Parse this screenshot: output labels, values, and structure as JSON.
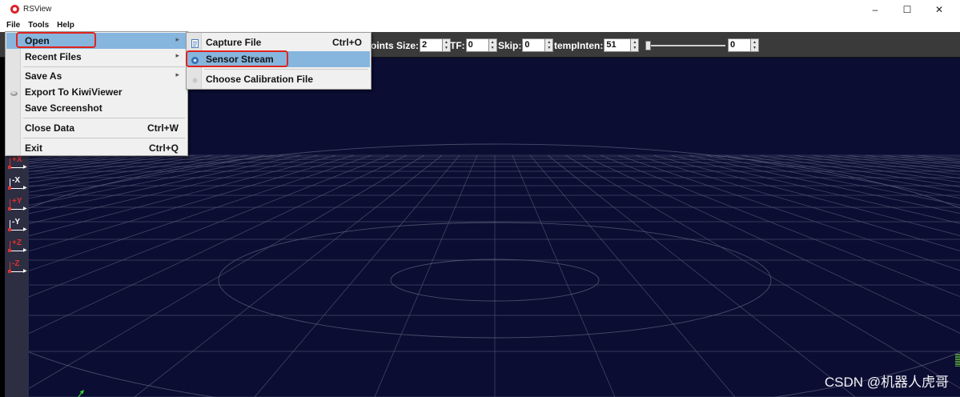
{
  "window": {
    "title": "RSView",
    "controls": {
      "minimize": "–",
      "maximize": "☐",
      "close": "✕"
    }
  },
  "menubar": {
    "items": [
      "File",
      "Tools",
      "Help"
    ]
  },
  "toolbar": {
    "points_size": {
      "label": "oints Size:",
      "value": "2"
    },
    "tf": {
      "label": "TF:",
      "value": "0"
    },
    "skip": {
      "label": "Skip:",
      "value": "0"
    },
    "temp_inten": {
      "label": "tempInten:",
      "value": "51"
    },
    "slider": {
      "value": "0"
    }
  },
  "file_menu": {
    "open": {
      "label": "Open",
      "arrow": "▸"
    },
    "recent_files": {
      "label": "Recent Files",
      "arrow": "▸"
    },
    "save_as": {
      "label": "Save As",
      "arrow": "▸"
    },
    "export_kiwiviewer": {
      "label": "Export To KiwiViewer"
    },
    "save_screenshot": {
      "label": "Save Screenshot"
    },
    "close_data": {
      "label": "Close Data",
      "shortcut": "Ctrl+W"
    },
    "exit": {
      "label": "Exit",
      "shortcut": "Ctrl+Q"
    }
  },
  "open_menu": {
    "capture_file": {
      "label": "Capture File",
      "shortcut": "Ctrl+O"
    },
    "sensor_stream": {
      "label": "Sensor Stream"
    },
    "choose_calibration": {
      "label": "Choose Calibration File"
    }
  },
  "axis_buttons": [
    {
      "label": "+X",
      "color": "#e03030"
    },
    {
      "label": "-X",
      "color": "#ffffff"
    },
    {
      "label": "+Y",
      "color": "#e03030"
    },
    {
      "label": "-Y",
      "color": "#ffffff"
    },
    {
      "label": "+Z",
      "color": "#e03030"
    },
    {
      "label": "-Z",
      "color": "#e03030"
    }
  ],
  "watermark": "CSDN @机器人虎哥",
  "colors": {
    "viewport_bg": "#0b0d33",
    "grid": "#5a5c78",
    "menu_highlight": "#86b5de",
    "annotation_red": "#e0241b"
  }
}
